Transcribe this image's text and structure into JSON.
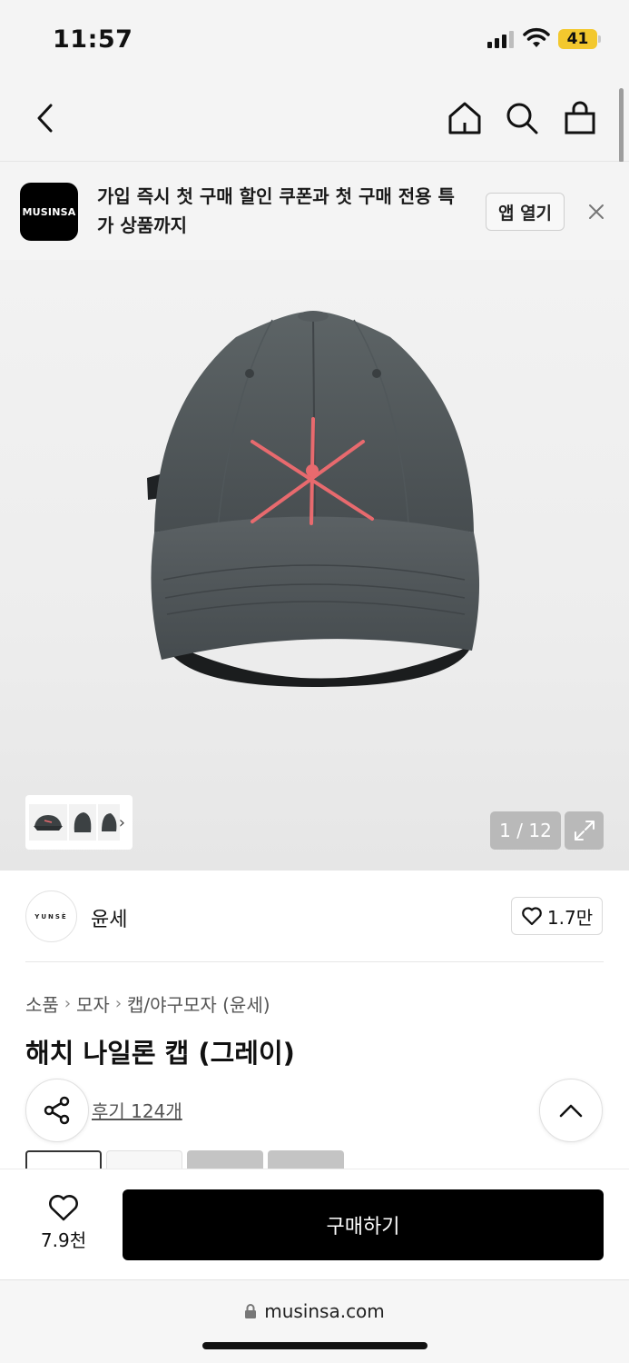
{
  "status_bar": {
    "time": "11:57",
    "battery": "41",
    "battery_color": "#f3c82e"
  },
  "navbar": {
    "back_icon": "chevron-left-icon",
    "home_icon": "home-icon",
    "search_icon": "search-icon",
    "cart_icon": "shopping-bag-icon"
  },
  "promo": {
    "logo_text": "MUSINSA",
    "text": "가입 즉시 첫 구매 할인 쿠폰과 첫 구매 전용 특가 상품까지",
    "open_label": "앱 열기",
    "close_icon": "close-icon"
  },
  "hero": {
    "counter": "1 / 12",
    "expand_icon": "expand-icon",
    "thumb_arrow": "›"
  },
  "brand": {
    "logo_text": "YUNSÈ",
    "name": "윤세",
    "like_count": "1.7만"
  },
  "breadcrumb": [
    "소품",
    "모자",
    "캡/야구모자 (윤세)"
  ],
  "product": {
    "title": "해치 나일론 캡 (그레이)",
    "review_label": "후기 124개"
  },
  "swatch_colors": [
    "#ffffff",
    "#f7f7f7",
    "#c4c4c4",
    "#c4c4c4"
  ],
  "action_bar": {
    "wish_count": "7.9천",
    "buy_label": "구매하기",
    "accent": "#000000"
  },
  "browser": {
    "url": "musinsa.com"
  }
}
